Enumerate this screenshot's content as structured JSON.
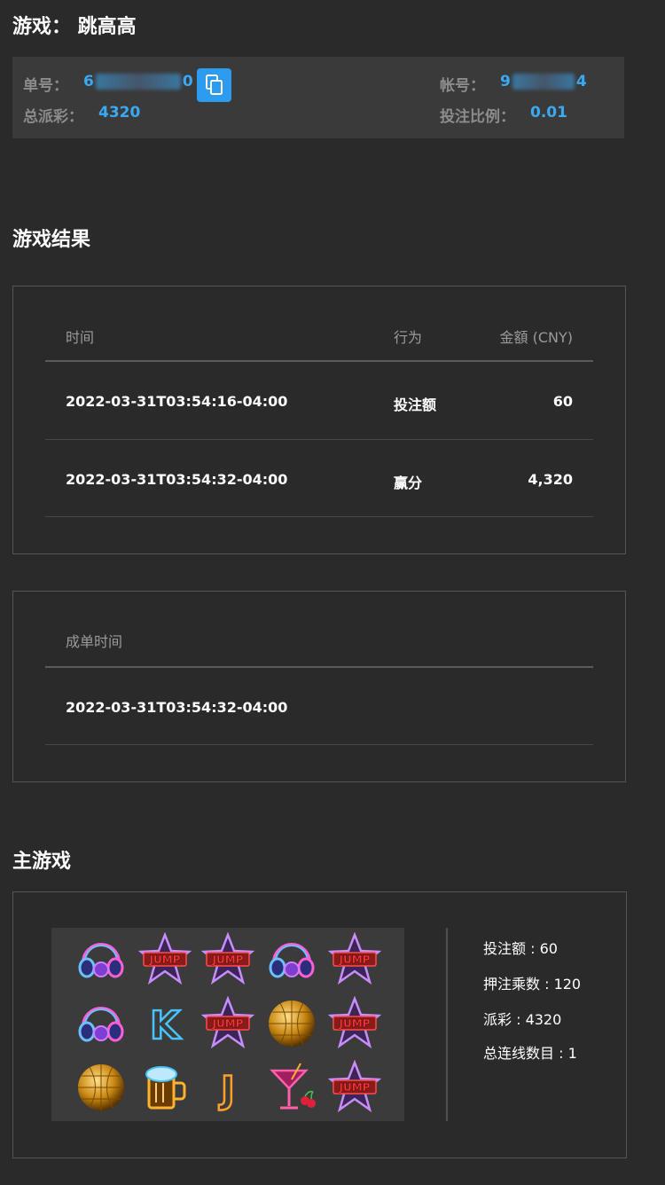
{
  "header": {
    "title": "游戏： 跳高高"
  },
  "order": {
    "order_label": "单号：",
    "order_prefix": "6",
    "order_suffix": "0",
    "payout_label": "总派彩：",
    "payout_value": "4320",
    "account_label": "帐号：",
    "account_prefix": "9",
    "account_suffix": "4",
    "ratio_label": "投注比例：",
    "ratio_value": "0.01"
  },
  "result": {
    "title": "游戏结果",
    "columns": [
      "时间",
      "行为",
      "金額 (CNY)"
    ],
    "rows": [
      {
        "time": "2022-03-31T03:54:16-04:00",
        "action": "投注额",
        "amount": "60"
      },
      {
        "time": "2022-03-31T03:54:32-04:00",
        "action": "赢分",
        "amount": "4,320"
      }
    ]
  },
  "settle": {
    "column": "成单时间",
    "value": "2022-03-31T03:54:32-04:00"
  },
  "main_game": {
    "title": "主游戏",
    "symbols": [
      [
        "headphones-icon",
        "jump-star-icon",
        "jump-star-icon",
        "headphones-icon",
        "jump-star-icon"
      ],
      [
        "headphones-icon",
        "letter-k-icon",
        "jump-star-icon",
        "disco-ball-icon",
        "jump-star-icon"
      ],
      [
        "disco-ball-icon",
        "beer-mug-icon",
        "letter-j-icon",
        "cocktail-icon",
        "jump-star-icon"
      ]
    ],
    "jump_text": "JUMP",
    "k_text": "K",
    "j_text": "J",
    "stats": {
      "bet": "投注额 : 60",
      "multiplier": "押注乘数 : 120",
      "payout": "派彩 : 4320",
      "lines": "总连线数目 : 1"
    }
  },
  "colors": {
    "accent": "#3aa9f4",
    "background": "#2a2a2a",
    "panel": "#3a3a3a"
  }
}
